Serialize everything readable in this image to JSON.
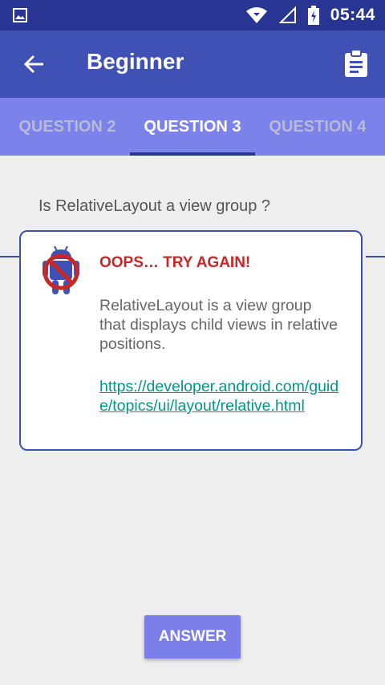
{
  "status_bar": {
    "time": "05:44"
  },
  "app_bar": {
    "title": "Beginner"
  },
  "tabs": [
    {
      "label": "QUESTION 2",
      "active": false
    },
    {
      "label": "QUESTION 3",
      "active": true
    },
    {
      "label": "QUESTION 4",
      "active": false
    }
  ],
  "question": {
    "text": "Is RelativeLayout a view group ?"
  },
  "feedback": {
    "heading": "OOPS… TRY AGAIN!",
    "explanation": "RelativeLayout is a view group that displays child views in relative positions.",
    "link": "https://developer.android.com/guide/topics/ui/layout/relative.html"
  },
  "answer_button": {
    "label": "ANSWER"
  },
  "colors": {
    "status_bar": "#283593",
    "app_bar": "#3f51b5",
    "tabs": "#7b83eb",
    "error": "#c62828",
    "link": "#009688",
    "button": "#7b7fe9"
  }
}
